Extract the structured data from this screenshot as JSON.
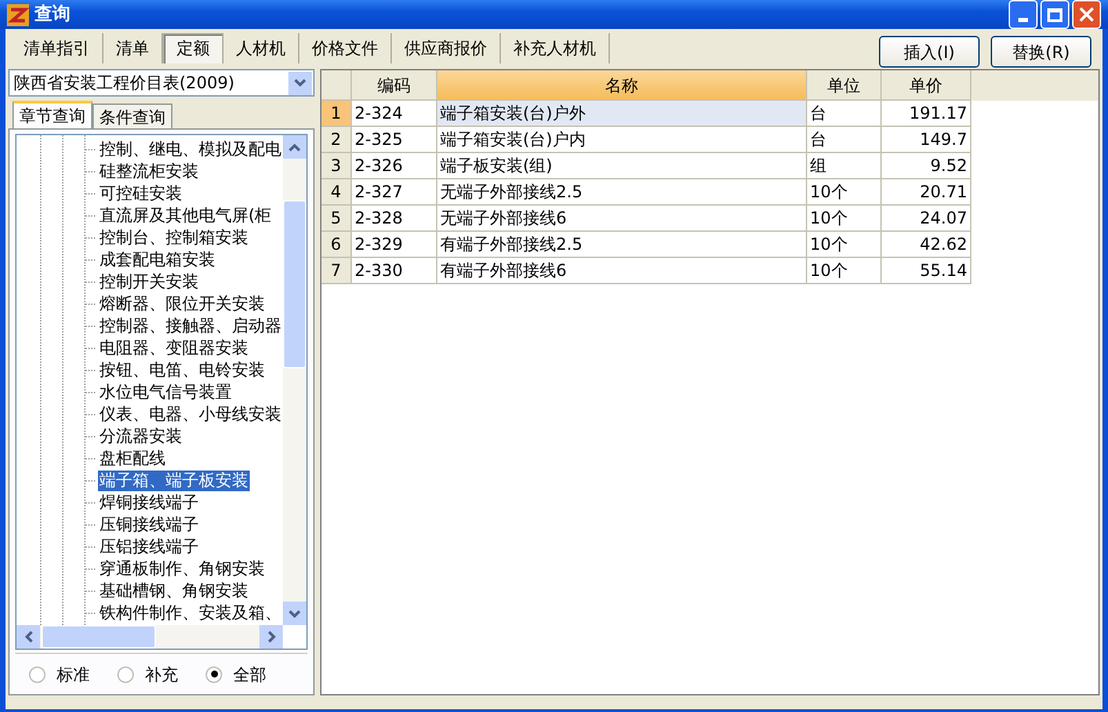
{
  "window": {
    "title": "查询"
  },
  "tabs": [
    {
      "label": "清单指引",
      "selected": false
    },
    {
      "label": "清单",
      "selected": false
    },
    {
      "label": "定额",
      "selected": true
    },
    {
      "label": "人材机",
      "selected": false
    },
    {
      "label": "价格文件",
      "selected": false
    },
    {
      "label": "供应商报价",
      "selected": false
    },
    {
      "label": "补充人材机",
      "selected": false
    }
  ],
  "buttons": [
    {
      "label": "插入(I)"
    },
    {
      "label": "替换(R)"
    }
  ],
  "library_select": {
    "value": "陕西省安装工程价目表(2009)"
  },
  "search_tabs": [
    {
      "label": "章节查询",
      "selected": true
    },
    {
      "label": "条件查询",
      "selected": false
    }
  ],
  "tree": {
    "items": [
      {
        "label": "控制、继电、模拟及配电",
        "selected": false
      },
      {
        "label": "硅整流柜安装",
        "selected": false
      },
      {
        "label": "可控硅安装",
        "selected": false
      },
      {
        "label": "直流屏及其他电气屏(柜",
        "selected": false
      },
      {
        "label": "控制台、控制箱安装",
        "selected": false
      },
      {
        "label": "成套配电箱安装",
        "selected": false
      },
      {
        "label": "控制开关安装",
        "selected": false
      },
      {
        "label": "熔断器、限位开关安装",
        "selected": false
      },
      {
        "label": "控制器、接触器、启动器",
        "selected": false
      },
      {
        "label": "电阻器、变阻器安装",
        "selected": false
      },
      {
        "label": "按钮、电笛、电铃安装",
        "selected": false
      },
      {
        "label": "水位电气信号装置",
        "selected": false
      },
      {
        "label": "仪表、电器、小母线安装",
        "selected": false
      },
      {
        "label": "分流器安装",
        "selected": false
      },
      {
        "label": "盘柜配线",
        "selected": false
      },
      {
        "label": "端子箱、端子板安装",
        "selected": true
      },
      {
        "label": "焊铜接线端子",
        "selected": false
      },
      {
        "label": "压铜接线端子",
        "selected": false
      },
      {
        "label": "压铝接线端子",
        "selected": false
      },
      {
        "label": "穿通板制作、角钢安装",
        "selected": false
      },
      {
        "label": "基础槽钢、角钢安装",
        "selected": false
      },
      {
        "label": "铁构件制作、安装及箱、",
        "selected": false
      }
    ]
  },
  "filter": [
    {
      "label": "标准",
      "selected": false
    },
    {
      "label": "补充",
      "selected": false
    },
    {
      "label": "全部",
      "selected": true
    }
  ],
  "table": {
    "columns": [
      "编码",
      "名称",
      "单位",
      "单价"
    ],
    "rows": [
      {
        "index": "1",
        "code": "2-324",
        "name": "端子箱安装(台)户外",
        "unit": "台",
        "price": "191.17",
        "selected": true
      },
      {
        "index": "2",
        "code": "2-325",
        "name": "端子箱安装(台)户内",
        "unit": "台",
        "price": "149.7",
        "selected": false
      },
      {
        "index": "3",
        "code": "2-326",
        "name": "端子板安装(组)",
        "unit": "组",
        "price": "9.52",
        "selected": false
      },
      {
        "index": "4",
        "code": "2-327",
        "name": "无端子外部接线2.5",
        "unit": "10个",
        "price": "20.71",
        "selected": false
      },
      {
        "index": "5",
        "code": "2-328",
        "name": "无端子外部接线6",
        "unit": "10个",
        "price": "24.07",
        "selected": false
      },
      {
        "index": "6",
        "code": "2-329",
        "name": "有端子外部接线2.5",
        "unit": "10个",
        "price": "42.62",
        "selected": false
      },
      {
        "index": "7",
        "code": "2-330",
        "name": "有端子外部接线6",
        "unit": "10个",
        "price": "55.14",
        "selected": false
      }
    ]
  }
}
